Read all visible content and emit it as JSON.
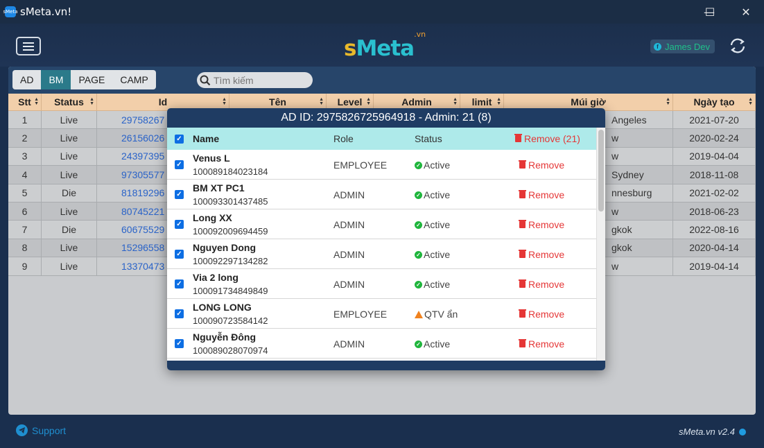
{
  "window": {
    "app_icon_text": "sMeta",
    "title": "sMeta.vn!",
    "minimize": "—",
    "maximize": "☐",
    "close": "✕"
  },
  "header": {
    "logo_s": "s",
    "logo_meta": "Meta",
    "logo_sup": ".vn",
    "user_name": "James Dev",
    "fb_letter": "f"
  },
  "toolbar": {
    "tabs": [
      "AD",
      "BM",
      "PAGE",
      "CAMP"
    ],
    "active_tab": "BM",
    "search_placeholder": "Tìm kiếm"
  },
  "table": {
    "columns": [
      "Stt",
      "Status",
      "Id",
      "Tên",
      "Level",
      "Admin",
      "limit",
      "Múi giờ",
      "Ngày tạo"
    ],
    "rows": [
      {
        "stt": "1",
        "status": "Live",
        "id": "29758267",
        "tz": "Angeles",
        "date": "2021-07-20"
      },
      {
        "stt": "2",
        "status": "Live",
        "id": "26156026",
        "tz": "w",
        "date": "2020-02-24"
      },
      {
        "stt": "3",
        "status": "Live",
        "id": "24397395",
        "tz": "w",
        "date": "2019-04-04"
      },
      {
        "stt": "4",
        "status": "Live",
        "id": "97305577",
        "tz": "Sydney",
        "date": "2018-11-08"
      },
      {
        "stt": "5",
        "status": "Die",
        "id": "81819296",
        "tz": "nnesburg",
        "date": "2021-02-02"
      },
      {
        "stt": "6",
        "status": "Live",
        "id": "80745221",
        "tz": "w",
        "date": "2018-06-23"
      },
      {
        "stt": "7",
        "status": "Die",
        "id": "60675529",
        "tz": "gkok",
        "date": "2022-08-16"
      },
      {
        "stt": "8",
        "status": "Live",
        "id": "15296558",
        "tz": "gkok",
        "date": "2020-04-14"
      },
      {
        "stt": "9",
        "status": "Live",
        "id": "13370473",
        "tz": "w",
        "date": "2019-04-14"
      }
    ]
  },
  "modal": {
    "title": "AD ID: 2975826725964918 - Admin: 21 (8)",
    "head_name": "Name",
    "head_role": "Role",
    "head_status": "Status",
    "head_remove": "Remove (21)",
    "rows": [
      {
        "name": "Venus L",
        "id": "100089184023184",
        "role": "EMPLOYEE",
        "status": "Active",
        "status_type": "ok",
        "remove": "Remove"
      },
      {
        "name": "BM XT PC1",
        "id": "100093301437485",
        "role": "ADMIN",
        "status": "Active",
        "status_type": "ok",
        "remove": "Remove"
      },
      {
        "name": "Long XX",
        "id": "100092009694459",
        "role": "ADMIN",
        "status": "Active",
        "status_type": "ok",
        "remove": "Remove"
      },
      {
        "name": "Nguyen Dong",
        "id": "100092297134282",
        "role": "ADMIN",
        "status": "Active",
        "status_type": "ok",
        "remove": "Remove"
      },
      {
        "name": "Via 2 long",
        "id": "100091734849849",
        "role": "ADMIN",
        "status": "Active",
        "status_type": "ok",
        "remove": "Remove"
      },
      {
        "name": "LONG LONG",
        "id": "100090723584142",
        "role": "EMPLOYEE",
        "status": "QTV ẩn",
        "status_type": "warn",
        "remove": "Remove"
      },
      {
        "name": "Nguyễn Đông",
        "id": "100089028070974",
        "role": "ADMIN",
        "status": "Active",
        "status_type": "ok",
        "remove": "Remove"
      }
    ]
  },
  "footer": {
    "support": "Support",
    "version": "sMeta.vn v2.4"
  },
  "colors": {
    "accent": "#2b7a8a",
    "header_bg": "#1f3455",
    "table_head": "#f2cfaa",
    "link": "#2a63c8",
    "remove": "#e53636",
    "active": "#1fb53c",
    "warn": "#f0821e"
  }
}
